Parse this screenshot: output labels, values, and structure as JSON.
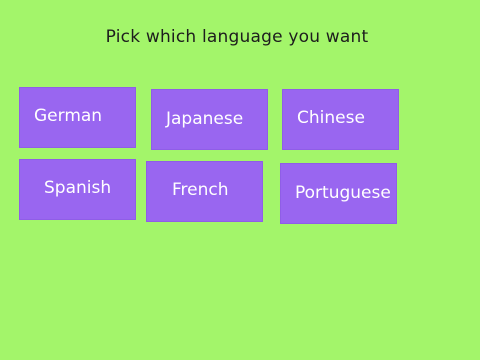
{
  "prompt": "Pick which language you want",
  "languages": [
    {
      "label": "German"
    },
    {
      "label": "Japanese"
    },
    {
      "label": "Chinese"
    },
    {
      "label": "Spanish"
    },
    {
      "label": "French"
    },
    {
      "label": "Portuguese"
    }
  ],
  "colors": {
    "background": "#a3f56a",
    "tile": "#9966f0",
    "tile_text": "#ffffff",
    "prompt_text": "#1d1d1d"
  }
}
